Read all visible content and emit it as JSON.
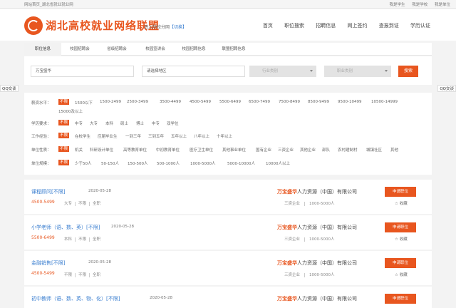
{
  "topbar": {
    "home": "网站首页_湖北省就业就业网",
    "links": [
      "我是学生",
      "我是学校",
      "我是单位"
    ]
  },
  "header": {
    "site_name": "湖北高校就业网络联盟",
    "sub_site": "进入院校分网",
    "sub_site_tag": "【切换】",
    "nav": [
      "首页",
      "职位搜索",
      "招聘信息",
      "网上签约",
      "查报到证",
      "学历认证"
    ]
  },
  "tabs": [
    "职位信息",
    "校园招聘会",
    "省级招聘会",
    "校园宣讲会",
    "校园招聘信息",
    "联盟招聘信息"
  ],
  "search": {
    "keyword": "万宝盛华",
    "area": "请选择地区",
    "industry": "行业类别",
    "job_type": "职业类别",
    "button": "搜索"
  },
  "qq": "QQ交谈",
  "filters": [
    {
      "label": "薪资水平：",
      "options": [
        "不限",
        "1500以下",
        "1500-2499",
        "2500-3499",
        "3500-4499",
        "4500-5499",
        "5500-6499",
        "6500-7499",
        "7500-8499",
        "8500-9499",
        "9500-10499",
        "10500-14999"
      ],
      "extra": "15000及以上"
    },
    {
      "label": "学历要求：",
      "options": [
        "不限",
        "中专",
        "大专",
        "本科",
        "硕士",
        "博士",
        "中专",
        "双学位"
      ]
    },
    {
      "label": "工作经验：",
      "options": [
        "不限",
        "在校学生",
        "应届毕业生",
        "一到三年",
        "三到五年",
        "五年以上",
        "八年以上",
        "十年以上"
      ]
    },
    {
      "label": "单位性质：",
      "options": [
        "不限",
        "机关",
        "科研设计单位",
        "高等教育单位",
        "中初教育单位",
        "医疗卫生单位",
        "其他事业单位",
        "国有企业",
        "三资企业",
        "其他企业",
        "部队",
        "农村建制村",
        "城镇社区",
        "其他"
      ]
    },
    {
      "label": "单位规模：",
      "options": [
        "不限",
        "少于50人",
        "50-150人",
        "150-500人",
        "500-1000人",
        "1000-5000人",
        "5000-10000人",
        "10000人以上"
      ]
    }
  ],
  "jobs": [
    {
      "title": "课程顾问[不限]",
      "date": "2020-05-28",
      "salary": "4500-5499",
      "edu": "大专",
      "exp": "不限",
      "loc": "全职",
      "company_hl": "万宝盛华",
      "company_rest": "人力资源（中国）有限公司",
      "ctype": "三资企业",
      "csize": "1000-5000人",
      "apply": "申请职位",
      "fav": "收藏"
    },
    {
      "title": "小学老师（语、数、英）[不限]",
      "date": "2020-05-28",
      "salary": "5500-6499",
      "edu": "本科",
      "exp": "不限",
      "loc": "全职",
      "company_hl": "万宝盛华",
      "company_rest": "人力资源（中国）有限公司",
      "ctype": "三资企业",
      "csize": "1000-5000人",
      "apply": "申请职位",
      "fav": "收藏"
    },
    {
      "title": "金融销售[不限]",
      "date": "2020-05-28",
      "salary": "4500-5499",
      "edu": "不限",
      "exp": "不限",
      "loc": "全职",
      "company_hl": "万宝盛华",
      "company_rest": "人力资源（中国）有限公司",
      "ctype": "三资企业",
      "csize": "1000-5000人",
      "apply": "申请职位",
      "fav": "收藏"
    },
    {
      "title": "初中教师（语、数、英、物、化）[不限]",
      "date": "2020-05-28",
      "salary": "",
      "edu": "",
      "exp": "",
      "loc": "",
      "company_hl": "万宝盛华",
      "company_rest": "人力资源（中国）有限公司",
      "ctype": "",
      "csize": "",
      "apply": "申请职位",
      "fav": ""
    }
  ]
}
